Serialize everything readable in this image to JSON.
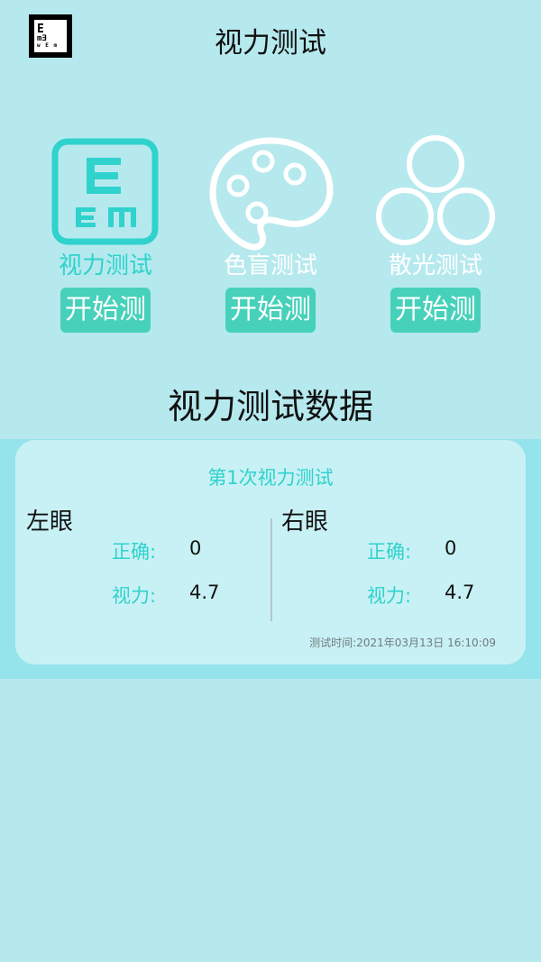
{
  "header": {
    "logo_lines": [
      "E",
      "m∃",
      "w E m"
    ],
    "title": "视力测试"
  },
  "tests": [
    {
      "label": "视力测试",
      "button": "开始测",
      "icon": "eye-chart-icon",
      "label_color": "#2fd2cc"
    },
    {
      "label": "色盲测试",
      "button": "开始测",
      "icon": "palette-icon",
      "label_color": "#ffffff"
    },
    {
      "label": "散光测试",
      "button": "开始测",
      "icon": "circles-icon",
      "label_color": "#ffffff"
    }
  ],
  "section_title": "视力测试数据",
  "record": {
    "title": "第1次视力测试",
    "left": {
      "name": "左眼",
      "correct_label": "正确:",
      "correct_value": "0",
      "vision_label": "视力:",
      "vision_value": "4.7"
    },
    "right": {
      "name": "右眼",
      "correct_label": "正确:",
      "correct_value": "0",
      "vision_label": "视力:",
      "vision_value": "4.7"
    },
    "time": "测试时间:2021年03月13日 16:10:09"
  },
  "colors": {
    "background": "#b6e9ee",
    "accent": "#2fd2cc",
    "button": "#47d1ba",
    "record_band": "#95e4ec",
    "record_card": "#c8f1f5"
  }
}
